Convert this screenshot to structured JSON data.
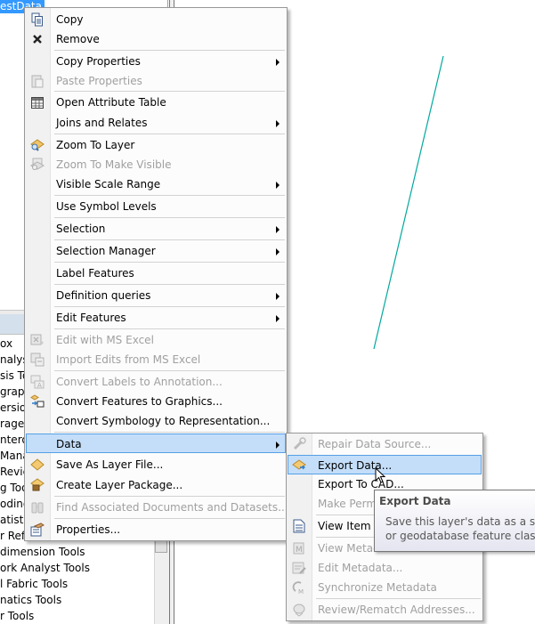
{
  "toc": {
    "selected_layer": "estData"
  },
  "toolbox": {
    "items": [
      "ox",
      "nalyst",
      "sis To",
      "graph",
      "ersion",
      "rage T",
      "ntero",
      "Mana",
      "Review",
      "g Too",
      "oding",
      "atistic",
      "r Refe",
      "dimension Tools",
      "ork Analyst Tools",
      "l Fabric Tools",
      "natics Tools",
      "r Tools"
    ]
  },
  "map": {
    "line_color": "#00a99d"
  },
  "context_menu": {
    "items": [
      {
        "label": "Copy",
        "icon": "copy-icon",
        "enabled": true,
        "submenu": false
      },
      {
        "label": "Remove",
        "icon": "remove-x-icon",
        "enabled": true,
        "submenu": false
      },
      {
        "label": "Copy Properties",
        "icon": "",
        "enabled": true,
        "submenu": true
      },
      {
        "label": "Paste Properties",
        "icon": "paste-icon",
        "enabled": false,
        "submenu": false
      },
      {
        "label": "Open Attribute Table",
        "icon": "table-icon",
        "enabled": true,
        "submenu": false
      },
      {
        "label": "Joins and Relates",
        "icon": "",
        "enabled": true,
        "submenu": true
      },
      {
        "label": "Zoom To Layer",
        "icon": "zoom-to-layer-icon",
        "enabled": true,
        "submenu": false
      },
      {
        "label": "Zoom To Make Visible",
        "icon": "zoom-visible-icon",
        "enabled": false,
        "submenu": false
      },
      {
        "label": "Visible Scale Range",
        "icon": "",
        "enabled": true,
        "submenu": true
      },
      {
        "label": "Use Symbol Levels",
        "icon": "",
        "enabled": true,
        "submenu": false
      },
      {
        "label": "Selection",
        "icon": "",
        "enabled": true,
        "submenu": true
      },
      {
        "label": "Selection Manager",
        "icon": "",
        "enabled": true,
        "submenu": true
      },
      {
        "label": "Label Features",
        "icon": "",
        "enabled": true,
        "submenu": false
      },
      {
        "label": "Definition queries",
        "icon": "",
        "enabled": true,
        "submenu": true
      },
      {
        "label": "Edit Features",
        "icon": "",
        "enabled": true,
        "submenu": true
      },
      {
        "label": "Edit with MS Excel",
        "icon": "excel-edit-icon",
        "enabled": false,
        "submenu": false
      },
      {
        "label": "Import Edits from MS Excel",
        "icon": "excel-import-icon",
        "enabled": false,
        "submenu": false
      },
      {
        "label": "Convert Labels to Annotation...",
        "icon": "labels-annotation-icon",
        "enabled": false,
        "submenu": false
      },
      {
        "label": "Convert Features to Graphics...",
        "icon": "features-graphics-icon",
        "enabled": true,
        "submenu": false
      },
      {
        "label": "Convert Symbology to Representation...",
        "icon": "",
        "enabled": true,
        "submenu": false
      },
      {
        "label": "Data",
        "icon": "",
        "enabled": true,
        "submenu": true,
        "highlighted": true
      },
      {
        "label": "Save As Layer File...",
        "icon": "layer-file-icon",
        "enabled": true,
        "submenu": false
      },
      {
        "label": "Create Layer Package...",
        "icon": "layer-package-icon",
        "enabled": true,
        "submenu": false
      },
      {
        "label": "Find Associated Documents and Datasets...",
        "icon": "binoculars-icon",
        "enabled": false,
        "submenu": false
      },
      {
        "label": "Properties...",
        "icon": "properties-icon",
        "enabled": true,
        "submenu": false
      }
    ]
  },
  "data_submenu": {
    "items": [
      {
        "label": "Repair Data Source...",
        "icon": "repair-icon",
        "enabled": false
      },
      {
        "label": "Export Data...",
        "icon": "export-data-icon",
        "enabled": true,
        "highlighted": true
      },
      {
        "label": "Export To CAD...",
        "icon": "",
        "enabled": true
      },
      {
        "label": "Make Permanent",
        "icon": "",
        "enabled": false
      },
      {
        "label": "View Item Description...",
        "icon": "item-description-icon",
        "enabled": true
      },
      {
        "label": "View Metadata...",
        "icon": "metadata-icon",
        "enabled": false
      },
      {
        "label": "Edit Metadata...",
        "icon": "edit-metadata-icon",
        "enabled": false
      },
      {
        "label": "Synchronize Metadata",
        "icon": "sync-metadata-icon",
        "enabled": false
      },
      {
        "label": "Review/Rematch Addresses...",
        "icon": "rematch-icon",
        "enabled": false
      }
    ]
  },
  "tooltip": {
    "title": "Export Data",
    "line1": "Save this layer's data as a shapefile",
    "line2": "or geodatabase feature class"
  }
}
